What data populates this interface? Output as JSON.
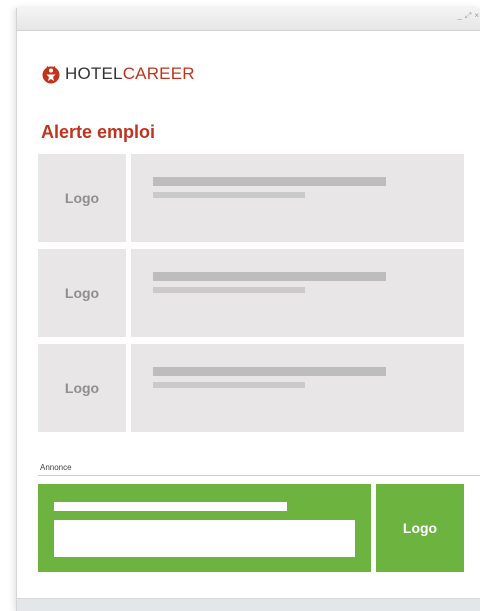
{
  "window": {
    "controls": [
      "_",
      "⤢",
      "×"
    ]
  },
  "brand": {
    "hotel": "HOTEL",
    "career": "CAREER",
    "icon": "hotelcareer-logo-icon",
    "accent_color": "#c0341d"
  },
  "heading": "Alerte emploi",
  "jobs": [
    {
      "logo_label": "Logo"
    },
    {
      "logo_label": "Logo"
    },
    {
      "logo_label": "Logo"
    }
  ],
  "ad": {
    "label": "Annonce",
    "logo_label": "Logo",
    "color": "#6db33f"
  }
}
